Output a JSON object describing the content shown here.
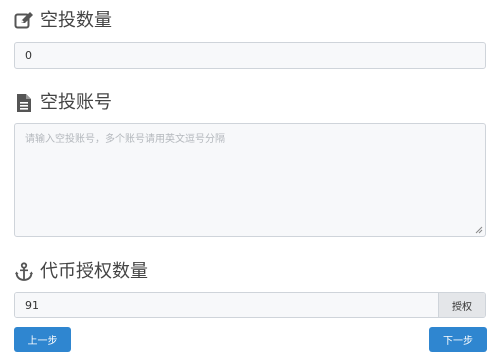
{
  "airdrop_amount": {
    "title": "空投数量",
    "icon": "edit-icon",
    "value": "0"
  },
  "airdrop_accounts": {
    "title": "空投账号",
    "icon": "document-icon",
    "placeholder": "请输入空投账号，多个账号请用英文逗号分隔"
  },
  "token_approval": {
    "title": "代币授权数量",
    "icon": "anchor-icon",
    "value": "91",
    "approve_label": "授权"
  },
  "nav": {
    "prev_label": "上一步",
    "next_label": "下一步"
  },
  "colors": {
    "primary": "#2f86d0",
    "input_bg": "#f7f8fa",
    "addon_bg": "#e4e6e9"
  }
}
